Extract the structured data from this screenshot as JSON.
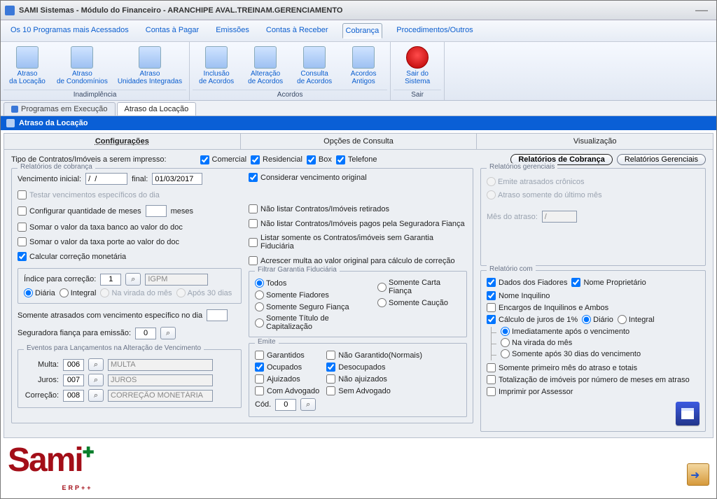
{
  "window": {
    "title": "SAMI Sistemas - Módulo do Financeiro - ARANCHIPE AVAL.TREINAM.GERENCIAMENTO"
  },
  "menubar": {
    "items": [
      "Os 10 Programas mais Acessados",
      "Contas à Pagar",
      "Emissões",
      "Contas à Receber",
      "Cobrança",
      "Procedimentos/Outros"
    ],
    "active_index": 4
  },
  "ribbon": {
    "groups": [
      {
        "caption": "Inadimplência",
        "items": [
          {
            "id": "atraso-locacao",
            "label": "Atraso\nda Locação"
          },
          {
            "id": "atraso-condominios",
            "label": "Atraso\nde Condomínios"
          },
          {
            "id": "atraso-unidades",
            "label": "Atraso\nUnidades Integradas"
          }
        ]
      },
      {
        "caption": "Acordos",
        "items": [
          {
            "id": "inclusao-acordos",
            "label": "Inclusão\nde Acordos"
          },
          {
            "id": "alteracao-acordos",
            "label": "Alteração\nde Acordos"
          },
          {
            "id": "consulta-acordos",
            "label": "Consulta\nde Acordos"
          },
          {
            "id": "acordos-antigos",
            "label": "Acordos\nAntigos"
          }
        ]
      },
      {
        "caption": "Sair",
        "items": [
          {
            "id": "sair-sistema",
            "label": "Sair do\nSistema",
            "red": true
          }
        ]
      }
    ]
  },
  "doc_tabs": {
    "items": [
      "Programas em Execução",
      "Atraso da Locação"
    ],
    "active_index": 1
  },
  "panel": {
    "title": "Atraso da Locação"
  },
  "subtabs": {
    "items": [
      "Configurações",
      "Opções de Consulta",
      "Visualização"
    ],
    "active_index": 0
  },
  "form": {
    "tipo_label": "Tipo de Contratos/Imóveis a serem impresso:",
    "tipo_opts": {
      "comercial": "Comercial",
      "residencial": "Residencial",
      "box": "Box",
      "telefone": "Telefone"
    },
    "report_buttons": {
      "cobranca": "Relatórios de Cobrança",
      "gerenciais": "Relatórios Gerenciais"
    },
    "rel_cob": {
      "legend": "Relatórios de cobrança",
      "venc_inicial_label": "Vencimento inicial:",
      "venc_inicial": "/  /",
      "final_label": "final:",
      "final": "01/03/2017",
      "considerar": "Considerar vencimento original",
      "testar": "Testar vencimentos específicos do dia",
      "config_meses": "Configurar quantidade de meses",
      "meses_suffix": "meses",
      "somar_banco": "Somar o valor da taxa banco ao valor do doc",
      "somar_porte": "Somar o valor da taxa porte ao valor do doc",
      "calc_corr": "Calcular correção monetária",
      "nao_listar_ret": "Não listar Contratos/Imóveis retirados",
      "nao_listar_pagos": "Não listar Contratos/Imóveis pagos pela Seguradora Fiança",
      "listar_sem_gar": "Listar somente os Contratos/imóveis sem Garantia Fiduciária",
      "acrescer": "Acrescer multa ao valor original para cálculo de correção",
      "indice_label": "Índice para correção:",
      "indice_val": "1",
      "indice_name": "IGPM",
      "diaria": "Diária",
      "integral": "Integral",
      "virada": "Na virada do mês",
      "apos30": "Após 30 dias",
      "somente_atras": "Somente atrasados com vencimento específico no dia",
      "seg_fianca_label": "Seguradora fiança para emissão:",
      "seg_fianca_val": "0",
      "eventos_legend": "Eventos para Lançamentos na Alteração de Vencimento",
      "multa_label": "Multa:",
      "multa_val": "006",
      "multa_name": "MULTA",
      "juros_label": "Juros:",
      "juros_val": "007",
      "juros_name": "JUROS",
      "corr_label": "Correção:",
      "corr_val": "008",
      "corr_name": "CORREÇÃO MONETÁRIA"
    },
    "filtrar_gar": {
      "legend": "Filtrar Garantia Fiduciária",
      "todos": "Todos",
      "carta": "Somente Carta Fiança",
      "fiadores": "Somente Fiadores",
      "caucao": "Somente Caução",
      "seguro": "Somente Seguro Fiança",
      "titulo": "Somente Título de Capitalização"
    },
    "emite": {
      "legend": "Emite",
      "garantidos": "Garantidos",
      "nao_garantido": "Não Garantido(Normais)",
      "ocupados": "Ocupados",
      "desocupados": "Desocupados",
      "ajuizados": "Ajuizados",
      "nao_ajuizados": "Não ajuizados",
      "com_adv": "Com Advogado",
      "sem_adv": "Sem Advogado",
      "cod_label": "Cód.",
      "cod_val": "0"
    },
    "rel_ger": {
      "legend": "Relatórios gerenciais",
      "emite_cron": "Emite atrasados crônicos",
      "atraso_ult": "Atraso somente do último mês",
      "mes_label": "Mês do atraso:",
      "mes_val": "/"
    },
    "rel_com": {
      "legend": "Relatório com",
      "dados_fiadores": "Dados dos Fiadores",
      "nome_prop": "Nome Proprietário",
      "nome_inq": "Nome Inquilino",
      "encargos": "Encargos de Inquilinos e Ambos",
      "calc_juros": "Cálculo de juros de 1%",
      "diario": "Diário",
      "integral": "Integral",
      "imediat": "Imediatamente após o vencimento",
      "virada": "Na virada do mês",
      "apos30": "Somente após 30 dias do vencimento",
      "somente_prim": "Somente primeiro mês do atraso e totais",
      "totalizacao": "Totalização de imóveis por  número de meses em atraso",
      "imprimir_ass": "Imprimir por Assessor"
    }
  },
  "logo": {
    "text": "Sami",
    "sub": "ERP++"
  }
}
